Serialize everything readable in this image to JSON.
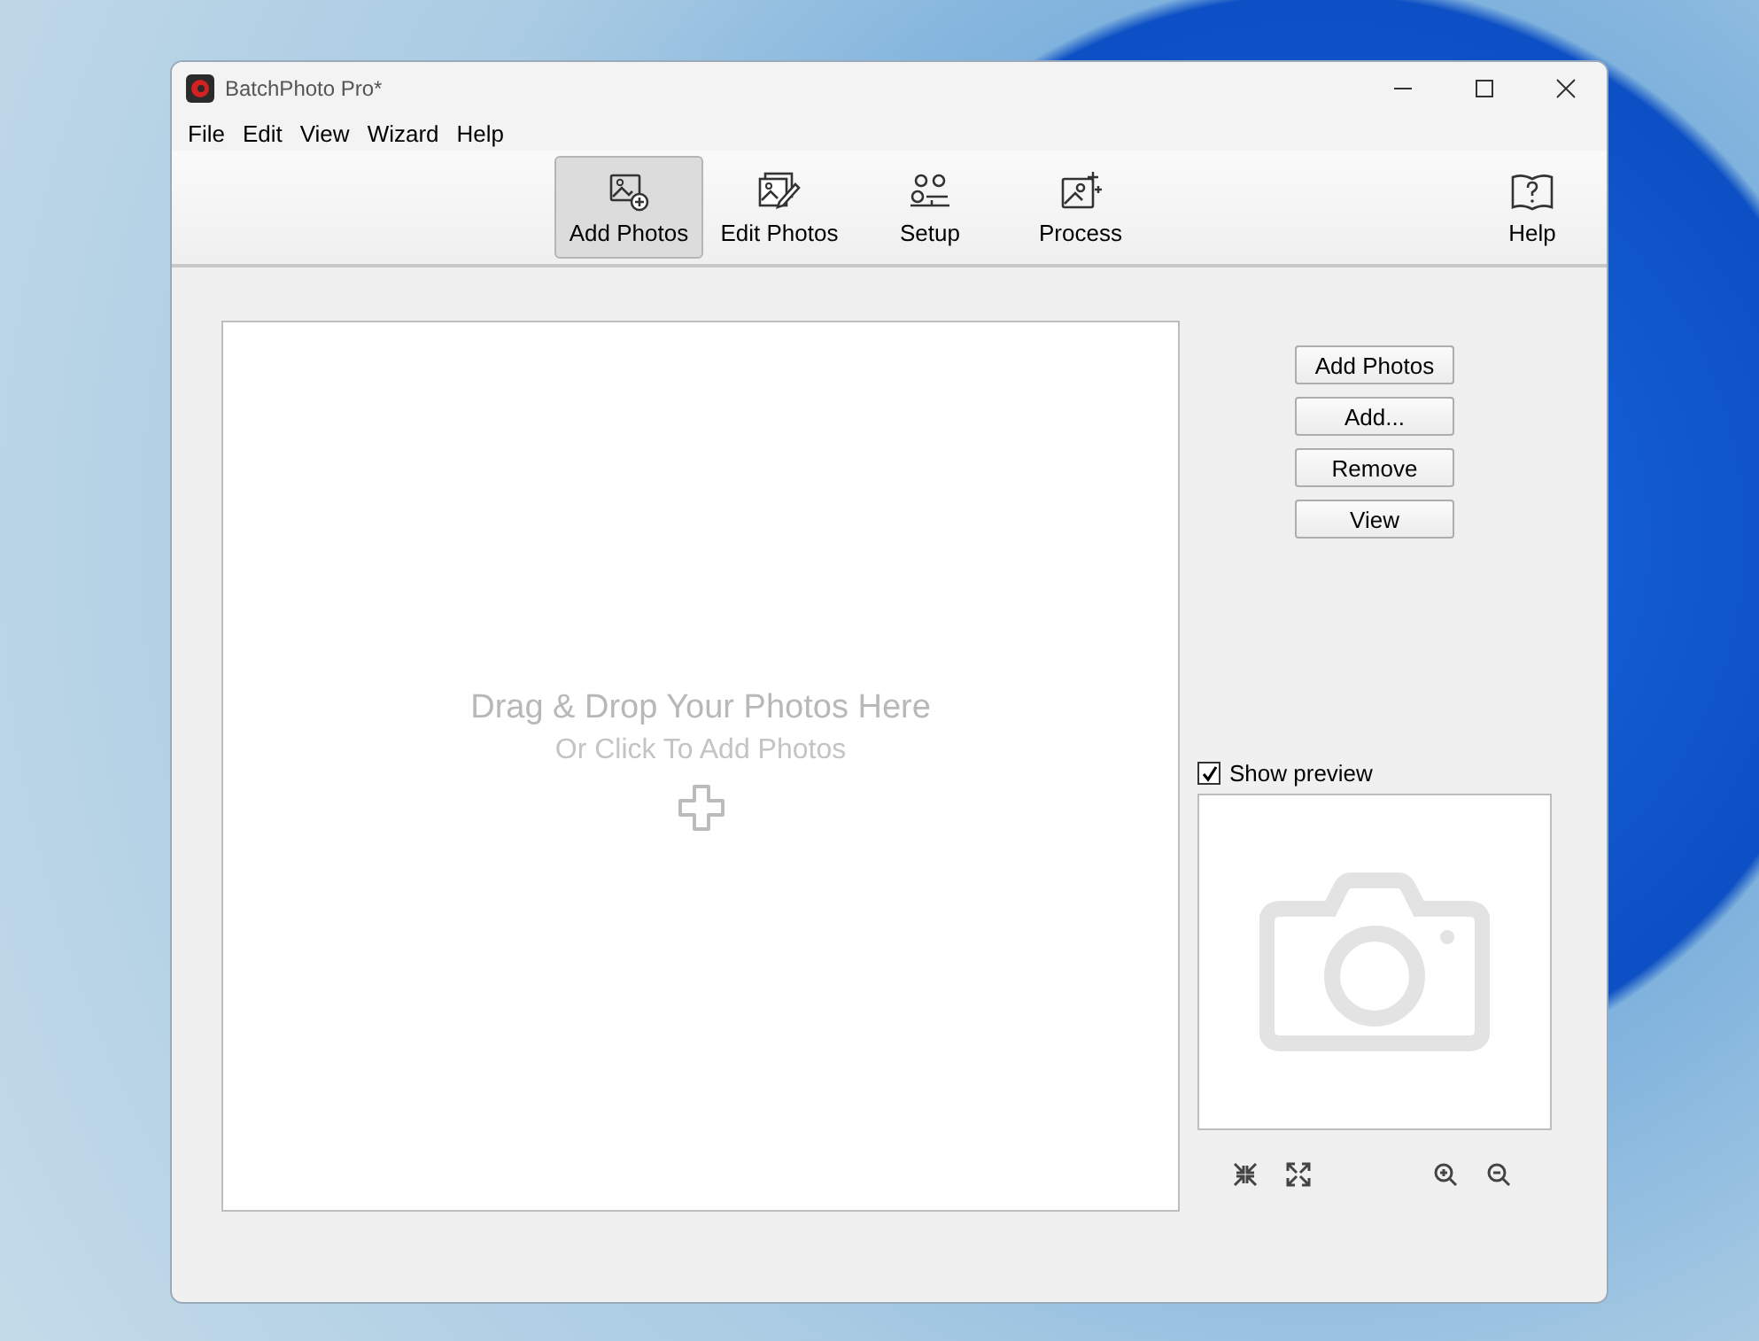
{
  "window": {
    "title": "BatchPhoto Pro*"
  },
  "menu": [
    {
      "label": "File"
    },
    {
      "label": "Edit"
    },
    {
      "label": "View"
    },
    {
      "label": "Wizard"
    },
    {
      "label": "Help"
    }
  ],
  "toolbar": [
    {
      "kind": "add",
      "label": "Add Photos",
      "selected": true
    },
    {
      "kind": "edit",
      "label": "Edit Photos",
      "selected": false
    },
    {
      "kind": "setup",
      "label": "Setup",
      "selected": false
    },
    {
      "kind": "process",
      "label": "Process",
      "selected": false
    },
    {
      "kind": "help",
      "label": "Help",
      "selected": false
    }
  ],
  "drop_zone": {
    "title": "Drag & Drop Your Photos Here",
    "subtitle": "Or Click To Add Photos"
  },
  "side_buttons": [
    "Add Photos",
    "Add...",
    "Remove",
    "View"
  ],
  "show_preview": {
    "label": "Show preview",
    "checked": true
  }
}
